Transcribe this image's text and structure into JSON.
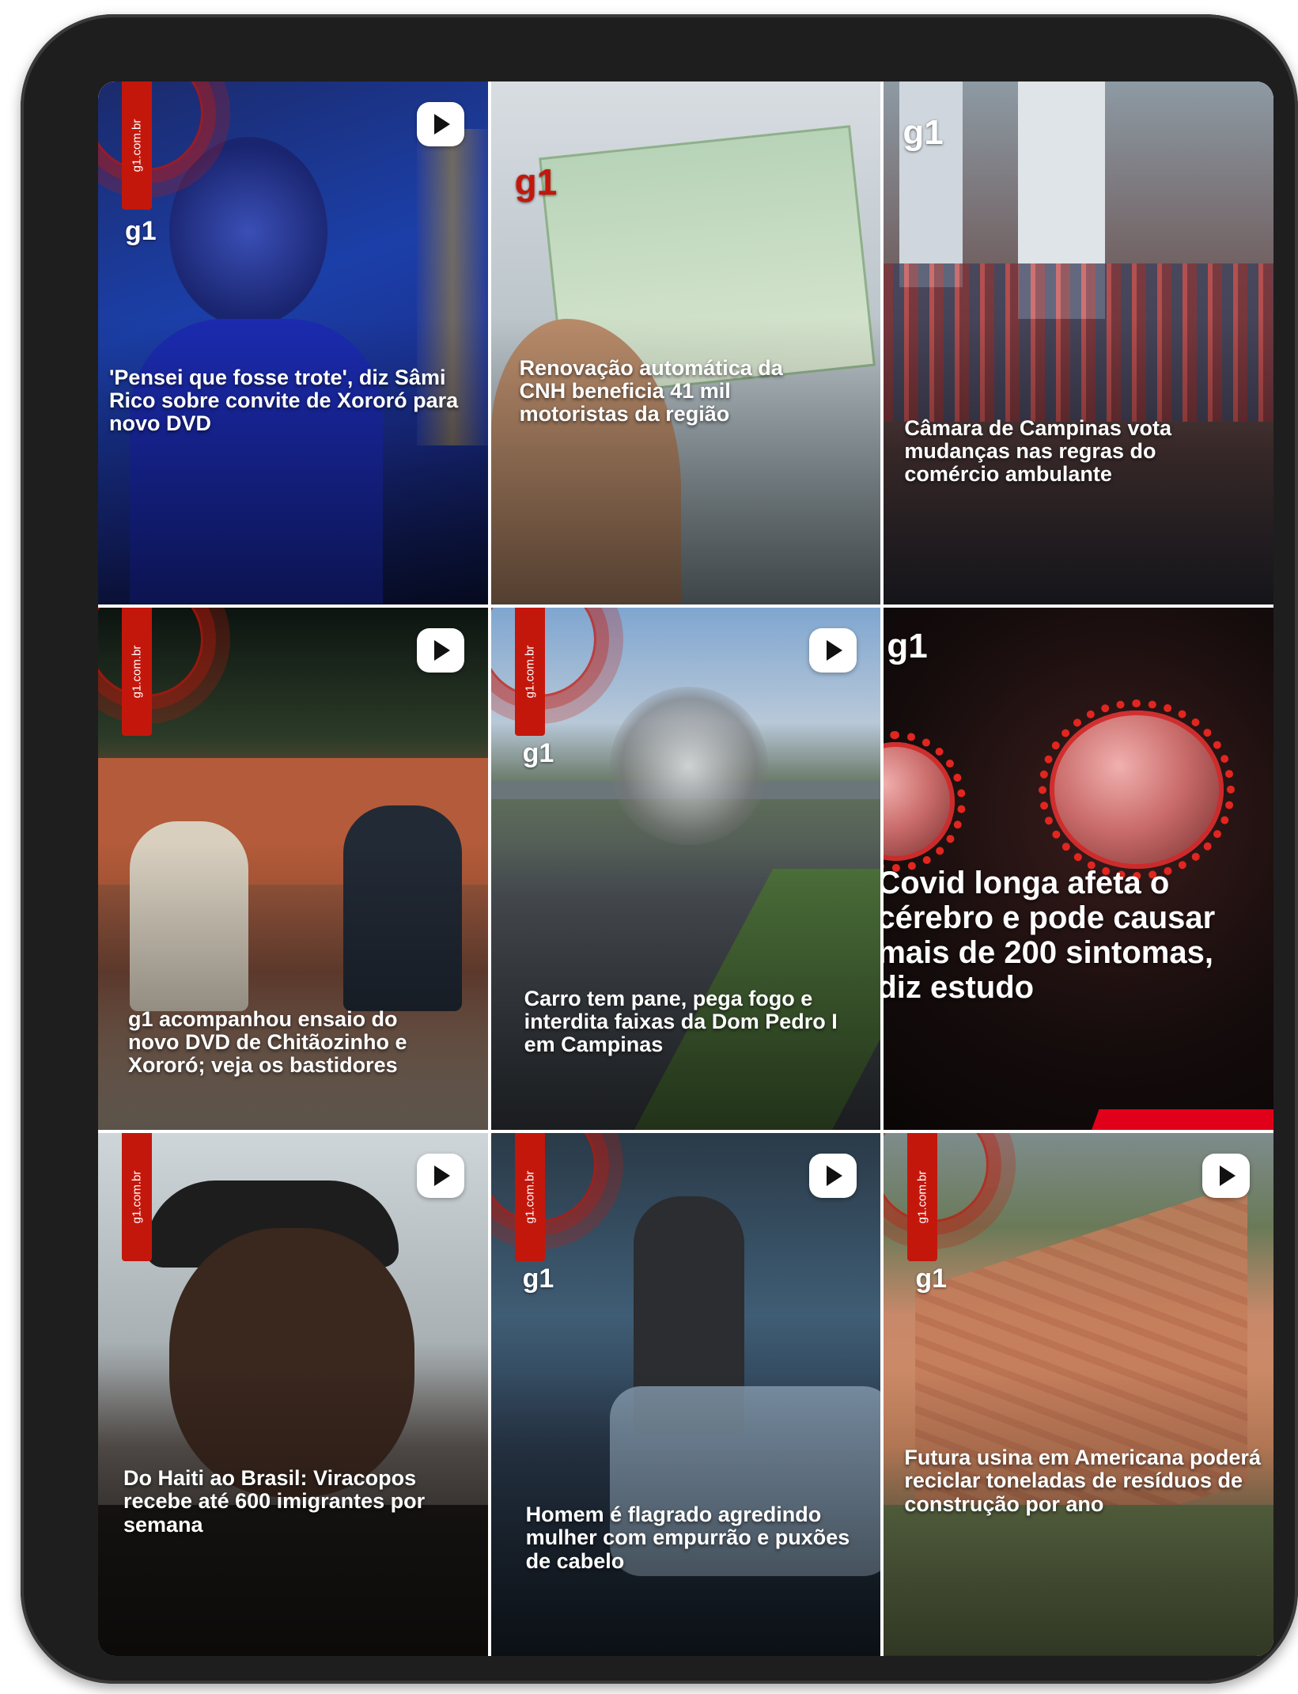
{
  "tiles": [
    {
      "caption": "'Pensei que fosse trote', diz Sâmi Rico sobre convite de Xororó para novo DVD",
      "badge": "g1.com.br",
      "logo": "g1",
      "video": true
    },
    {
      "caption": "Renovação automática da CNH beneficia 41 mil motoristas da região",
      "badge": "",
      "logo": "g1",
      "video": false
    },
    {
      "caption": "Câmara de Campinas vota mudanças nas regras do comércio ambulante",
      "badge": "",
      "logo": "g1",
      "video": false
    },
    {
      "caption": "g1 acompanhou ensaio do novo DVD de Chitãozinho e Xororó; veja os bastidores",
      "badge": "g1.com.br",
      "logo": "",
      "video": true
    },
    {
      "caption": "Carro tem pane, pega fogo e interdita faixas da Dom Pedro I em Campinas",
      "badge": "g1.com.br",
      "logo": "g1",
      "video": true
    },
    {
      "caption": "Covid longa afeta o cérebro e pode causar mais de 200 sintomas, diz estudo",
      "badge": "",
      "logo": "g1",
      "video": false
    },
    {
      "caption": "Do Haiti ao Brasil: Viracopos recebe até 600 imigrantes por semana",
      "badge": "g1.com.br",
      "logo": "",
      "video": true
    },
    {
      "caption": "Homem é flagrado agredindo mulher com empurrão e puxões de cabelo",
      "badge": "g1.com.br",
      "logo": "g1",
      "video": true
    },
    {
      "caption": "Futura usina em Americana poderá reciclar toneladas de resíduos de construção por ano",
      "badge": "g1.com.br",
      "logo": "g1",
      "video": true
    }
  ],
  "colors": {
    "brand": "#c4170c",
    "device_frame": "#1e1e1e"
  },
  "icons": [
    "play-icon",
    "g1-logo"
  ]
}
